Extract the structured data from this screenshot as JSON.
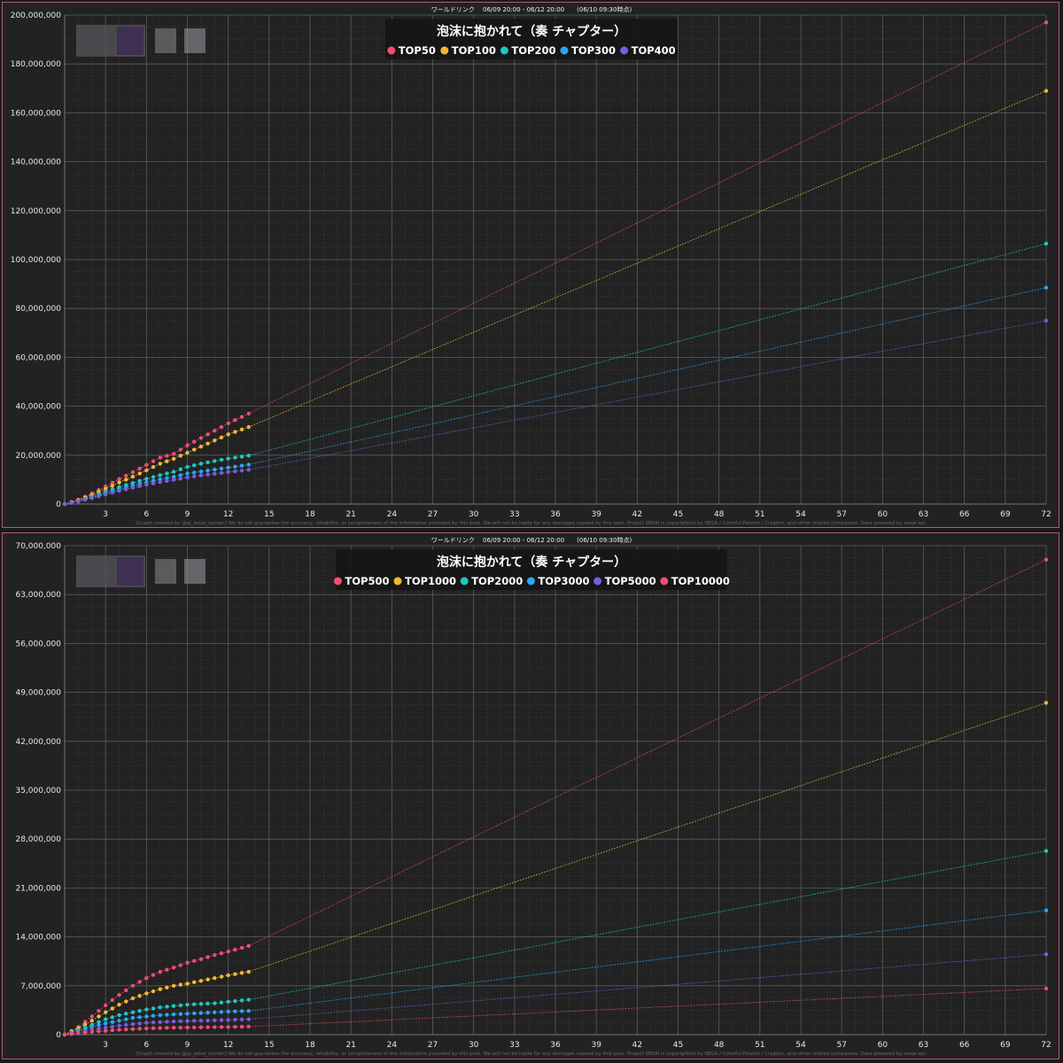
{
  "charts": [
    {
      "header": "ワールドリンク　 06/09 20:00 - 06/12 20:00　　(06/10 09:30時点)",
      "footer": "[Graph created by @pj_sekai_border]  We do not guarantee the accuracy, reliability, or completeness of the information provided by this post. We will not be liable for any damages caused by this post. Project SEKAI is copyrighted by SEGA / Colorful Palette / Crypton, and other related companies. Data powered by sekai-api.",
      "chart_data": {
        "type": "line",
        "title": "泡沫に抱かれて（奏 チャプター）",
        "xlim": [
          0,
          72
        ],
        "ylim": [
          0,
          200000000
        ],
        "x_ticks": [
          3,
          6,
          9,
          12,
          15,
          18,
          21,
          24,
          27,
          30,
          33,
          36,
          39,
          42,
          45,
          48,
          51,
          54,
          57,
          60,
          63,
          66,
          69,
          72
        ],
        "y_ticks": [
          0,
          20000000,
          40000000,
          60000000,
          80000000,
          100000000,
          120000000,
          140000000,
          160000000,
          180000000,
          200000000
        ],
        "y_tick_labels": [
          "0",
          "20,000,000",
          "40,000,000",
          "60,000,000",
          "80,000,000",
          "100,000,000",
          "120,000,000",
          "140,000,000",
          "160,000,000",
          "180,000,000",
          "200,000,000"
        ],
        "grid": true,
        "legend_position": "top-center",
        "observed_until_x": 13.5,
        "series": [
          {
            "name": "TOP50",
            "color": "#ee4d72",
            "curve": [
              [
                0,
                0
              ],
              [
                1,
                1800000
              ],
              [
                2,
                4300000
              ],
              [
                3,
                7200000
              ],
              [
                4,
                10200000
              ],
              [
                5,
                13000000
              ],
              [
                6,
                16000000
              ],
              [
                7,
                19000000
              ],
              [
                8,
                20500000
              ],
              [
                9,
                24000000
              ],
              [
                10,
                27000000
              ],
              [
                11,
                30000000
              ],
              [
                12,
                33000000
              ],
              [
                13.5,
                37000000
              ]
            ],
            "projected_end": 197000000
          },
          {
            "name": "TOP100",
            "color": "#f5b730",
            "curve": [
              [
                0,
                0
              ],
              [
                1,
                1500000
              ],
              [
                2,
                3700000
              ],
              [
                3,
                6200000
              ],
              [
                4,
                8800000
              ],
              [
                5,
                11200000
              ],
              [
                6,
                13800000
              ],
              [
                7,
                16500000
              ],
              [
                8,
                18500000
              ],
              [
                9,
                21000000
              ],
              [
                10,
                23500000
              ],
              [
                11,
                26000000
              ],
              [
                12,
                28500000
              ],
              [
                13.5,
                31500000
              ]
            ],
            "projected_end": 169000000
          },
          {
            "name": "TOP200",
            "color": "#1ec8c0",
            "curve": [
              [
                0,
                0
              ],
              [
                1,
                1200000
              ],
              [
                2,
                3000000
              ],
              [
                3,
                5000000
              ],
              [
                4,
                6900000
              ],
              [
                5,
                8600000
              ],
              [
                6,
                10300000
              ],
              [
                7,
                11800000
              ],
              [
                8,
                13200000
              ],
              [
                9,
                15200000
              ],
              [
                10,
                16500000
              ],
              [
                11,
                17600000
              ],
              [
                12,
                18600000
              ],
              [
                13.5,
                19800000
              ]
            ],
            "projected_end": 106500000
          },
          {
            "name": "TOP300",
            "color": "#2aa6f5",
            "curve": [
              [
                0,
                0
              ],
              [
                1,
                1100000
              ],
              [
                2,
                2700000
              ],
              [
                3,
                4400000
              ],
              [
                4,
                6000000
              ],
              [
                5,
                7500000
              ],
              [
                6,
                8900000
              ],
              [
                7,
                10100000
              ],
              [
                8,
                11100000
              ],
              [
                9,
                12500000
              ],
              [
                10,
                13300000
              ],
              [
                11,
                14100000
              ],
              [
                12,
                14900000
              ],
              [
                13.5,
                16100000
              ]
            ],
            "projected_end": 88500000
          },
          {
            "name": "TOP400",
            "color": "#7a5cde",
            "curve": [
              [
                0,
                0
              ],
              [
                1,
                1000000
              ],
              [
                2,
                2400000
              ],
              [
                3,
                3900000
              ],
              [
                4,
                5400000
              ],
              [
                5,
                6700000
              ],
              [
                6,
                7900000
              ],
              [
                7,
                9000000
              ],
              [
                8,
                9900000
              ],
              [
                9,
                10900000
              ],
              [
                10,
                11700000
              ],
              [
                11,
                12400000
              ],
              [
                12,
                13100000
              ],
              [
                13.5,
                14000000
              ]
            ],
            "projected_end": 75000000
          }
        ]
      }
    },
    {
      "header": "ワールドリンク　 06/09 20:00 - 06/12 20:00　　(06/10 09:30時点)",
      "footer": "[Graph created by @pj_sekai_border]  We do not guarantee the accuracy, reliability, or completeness of the information provided by this post. We will not be liable for any damages caused by this post. Project SEKAI is copyrighted by SEGA / Colorful Palette / Crypton, and other related companies. Data powered by sekai-api.",
      "chart_data": {
        "type": "line",
        "title": "泡沫に抱かれて（奏 チャプター）",
        "xlim": [
          0,
          72
        ],
        "ylim": [
          0,
          70000000
        ],
        "x_ticks": [
          3,
          6,
          9,
          12,
          15,
          18,
          21,
          24,
          27,
          30,
          33,
          36,
          39,
          42,
          45,
          48,
          51,
          54,
          57,
          60,
          63,
          66,
          69,
          72
        ],
        "y_ticks": [
          0,
          7000000,
          14000000,
          21000000,
          28000000,
          35000000,
          42000000,
          49000000,
          56000000,
          63000000,
          70000000
        ],
        "y_tick_labels": [
          "0",
          "7,000,000",
          "14,000,000",
          "21,000,000",
          "28,000,000",
          "35,000,000",
          "42,000,000",
          "49,000,000",
          "56,000,000",
          "63,000,000",
          "70,000,000"
        ],
        "grid": true,
        "legend_position": "top-center",
        "observed_until_x": 13.5,
        "series": [
          {
            "name": "TOP500",
            "color": "#ee4d72",
            "curve": [
              [
                0,
                0
              ],
              [
                1,
                1100000
              ],
              [
                2,
                2600000
              ],
              [
                3,
                4200000
              ],
              [
                4,
                5700000
              ],
              [
                5,
                7000000
              ],
              [
                6,
                8100000
              ],
              [
                7,
                9000000
              ],
              [
                8,
                9600000
              ],
              [
                9,
                10300000
              ],
              [
                10,
                10800000
              ],
              [
                11,
                11400000
              ],
              [
                12,
                11900000
              ],
              [
                13.5,
                12700000
              ]
            ],
            "projected_end": 68000000
          },
          {
            "name": "TOP1000",
            "color": "#f5b730",
            "curve": [
              [
                0,
                0
              ],
              [
                1,
                900000
              ],
              [
                2,
                2000000
              ],
              [
                3,
                3200000
              ],
              [
                4,
                4300000
              ],
              [
                5,
                5200000
              ],
              [
                6,
                5900000
              ],
              [
                7,
                6500000
              ],
              [
                8,
                7000000
              ],
              [
                9,
                7300000
              ],
              [
                10,
                7700000
              ],
              [
                11,
                8100000
              ],
              [
                12,
                8500000
              ],
              [
                13.5,
                9000000
              ]
            ],
            "projected_end": 47500000
          },
          {
            "name": "TOP2000",
            "color": "#1ec8c0",
            "curve": [
              [
                0,
                0
              ],
              [
                1,
                600000
              ],
              [
                2,
                1400000
              ],
              [
                3,
                2200000
              ],
              [
                4,
                2800000
              ],
              [
                5,
                3200000
              ],
              [
                6,
                3600000
              ],
              [
                7,
                3900000
              ],
              [
                8,
                4100000
              ],
              [
                9,
                4300000
              ],
              [
                10,
                4400000
              ],
              [
                11,
                4500000
              ],
              [
                12,
                4700000
              ],
              [
                13.5,
                5000000
              ]
            ],
            "projected_end": 26300000
          },
          {
            "name": "TOP3000",
            "color": "#2aa6f5",
            "curve": [
              [
                0,
                0
              ],
              [
                1,
                500000
              ],
              [
                2,
                1100000
              ],
              [
                3,
                1600000
              ],
              [
                4,
                2000000
              ],
              [
                5,
                2400000
              ],
              [
                6,
                2600000
              ],
              [
                7,
                2800000
              ],
              [
                8,
                2900000
              ],
              [
                9,
                3000000
              ],
              [
                10,
                3100000
              ],
              [
                11,
                3200000
              ],
              [
                12,
                3300000
              ],
              [
                13.5,
                3400000
              ]
            ],
            "projected_end": 17800000
          },
          {
            "name": "TOP5000",
            "color": "#7a5cde",
            "curve": [
              [
                0,
                0
              ],
              [
                1,
                300000
              ],
              [
                2,
                700000
              ],
              [
                3,
                1000000
              ],
              [
                4,
                1300000
              ],
              [
                5,
                1500000
              ],
              [
                6,
                1700000
              ],
              [
                7,
                1800000
              ],
              [
                8,
                1900000
              ],
              [
                9,
                1950000
              ],
              [
                10,
                2000000
              ],
              [
                11,
                2050000
              ],
              [
                12,
                2100000
              ],
              [
                13.5,
                2200000
              ]
            ],
            "projected_end": 11500000
          },
          {
            "name": "TOP10000",
            "color": "#ee4d72",
            "curve": [
              [
                0,
                0
              ],
              [
                1,
                200000
              ],
              [
                2,
                400000
              ],
              [
                3,
                550000
              ],
              [
                4,
                700000
              ],
              [
                5,
                800000
              ],
              [
                6,
                900000
              ],
              [
                7,
                950000
              ],
              [
                8,
                1000000
              ],
              [
                9,
                1020000
              ],
              [
                10,
                1050000
              ],
              [
                11,
                1080000
              ],
              [
                12,
                1100000
              ],
              [
                13.5,
                1150000
              ]
            ],
            "projected_end": 6600000
          }
        ]
      }
    }
  ]
}
